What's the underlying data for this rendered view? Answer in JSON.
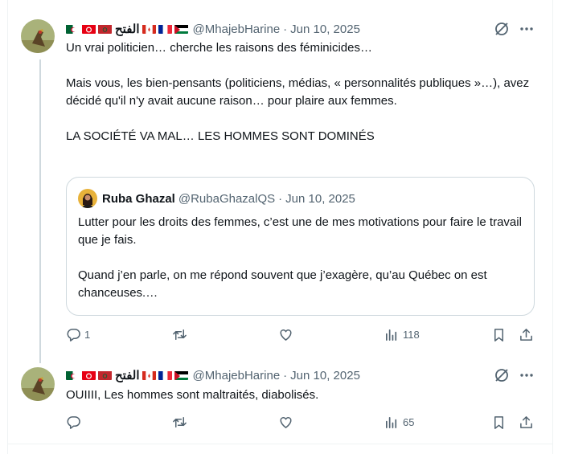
{
  "colors": {
    "text": "#0f1419",
    "muted": "#536471",
    "border": "#cfd9de"
  },
  "tweets": [
    {
      "arabic_name": "الفتح",
      "handle": "@MhajebHarine",
      "dot": "·",
      "date": "Jun 10, 2025",
      "text": "Un vrai politicien… cherche les raisons des féminicides…\n\nMais vous, les bien-pensants (politiciens, médias, « personnalités publiques »…), avez décidé qu'il n'y avait aucune raison… pour plaire aux femmes.\n\nLA SOCIÉTÉ VA MAL… LES HOMMES SONT DOMINÉS",
      "quote": {
        "name": "Ruba Ghazal",
        "handle": "@RubaGhazalQS",
        "dot": "·",
        "date": "Jun 10, 2025",
        "text": "Lutter pour les droits des femmes, c’est une de mes motivations pour faire le travail que je fais.\n\nQuand j’en parle, on me répond souvent que j’exagère, qu’au Québec on est chanceuses.…"
      },
      "replies": "1",
      "views": "118"
    },
    {
      "arabic_name": "الفتح",
      "handle": "@MhajebHarine",
      "dot": "·",
      "date": "Jun 10, 2025",
      "text": "OUIIII,  Les hommes sont maltraités, diabolisés.",
      "replies": "",
      "views": "65"
    }
  ]
}
